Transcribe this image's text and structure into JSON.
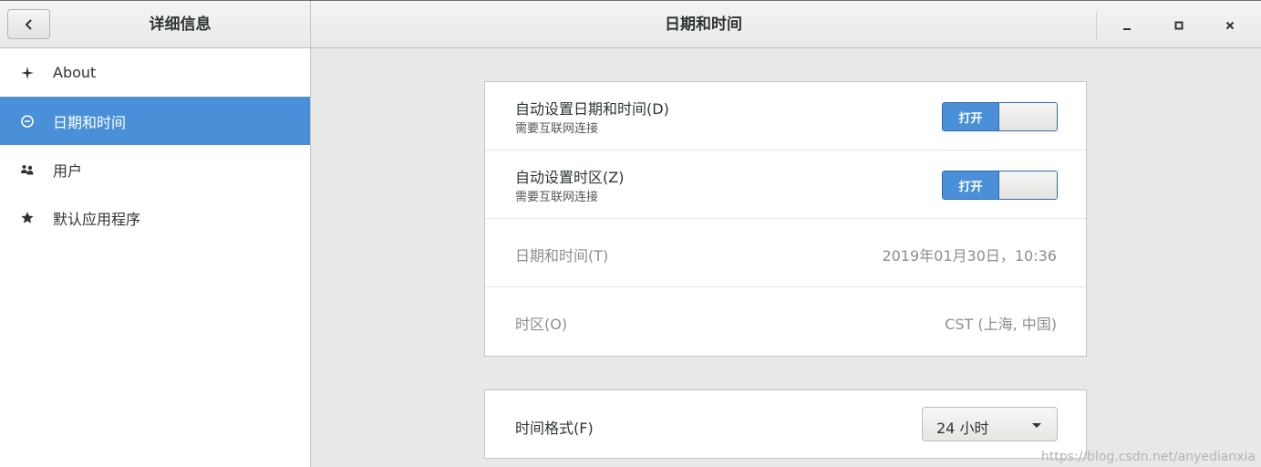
{
  "header": {
    "left_title": "详细信息",
    "center_title": "日期和时间",
    "back_icon": "chevron-left-icon",
    "minimize_icon": "minimize-icon",
    "maximize_icon": "maximize-icon",
    "close_icon": "close-icon"
  },
  "sidebar": {
    "items": [
      {
        "label": "About",
        "icon": "sparkle-icon",
        "active": false
      },
      {
        "label": "日期和时间",
        "icon": "clock-icon",
        "active": true
      },
      {
        "label": "用户",
        "icon": "users-icon",
        "active": false
      },
      {
        "label": "默认应用程序",
        "icon": "star-icon",
        "active": false
      }
    ]
  },
  "main": {
    "auto_datetime": {
      "title": "自动设置日期和时间(D)",
      "subtitle": "需要互联网连接",
      "switch_label": "打开",
      "enabled": true
    },
    "auto_timezone": {
      "title": "自动设置时区(Z)",
      "subtitle": "需要互联网连接",
      "switch_label": "打开",
      "enabled": true
    },
    "datetime": {
      "title": "日期和时间(T)",
      "value": "2019年01月30日，10:36"
    },
    "timezone": {
      "title": "时区(O)",
      "value": "CST (上海, 中国)"
    },
    "time_format": {
      "title": "时间格式(F)",
      "selected": "24 小时"
    }
  },
  "watermark": "https://blog.csdn.net/anyedianxia",
  "colors": {
    "accent": "#4a90d9",
    "sidebar_bg": "#ffffff",
    "content_bg": "#e8e8e7"
  }
}
